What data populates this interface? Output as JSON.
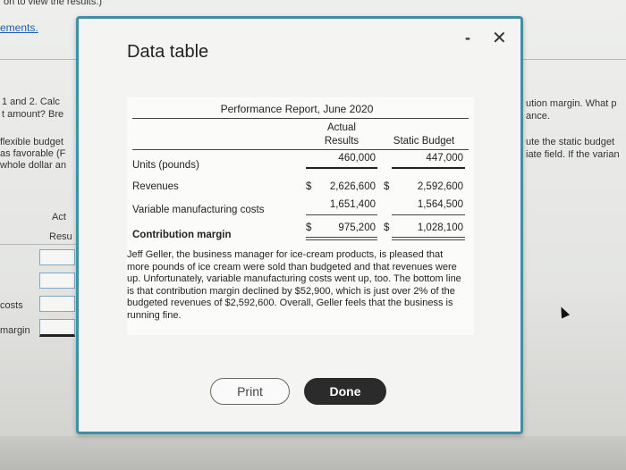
{
  "background": {
    "top_text": "on to view the results.)",
    "link_text": "ements.",
    "left_q1": "1 and 2. Calc",
    "left_q2": "t amount? Bre",
    "left_p1": "flexible budget",
    "left_p2": "as favorable (F",
    "left_p3": "whole dollar an",
    "col_actual": "Act",
    "col_results": "Resu",
    "row_costs": "costs",
    "row_margin": "margin",
    "right_1": "ution margin. What p",
    "right_2": "ance.",
    "right_3": "ute the static budget",
    "right_4": "iate field. If the varian"
  },
  "modal": {
    "title": "Data table",
    "minimize_symbol": "-",
    "close_symbol": "✕",
    "report": {
      "title": "Performance Report, June 2020",
      "col_actual_1": "Actual",
      "col_actual_2": "Results",
      "col_static": "Static Budget",
      "rows": {
        "units": {
          "label": "Units (pounds)",
          "actual": "460,000",
          "static": "447,000"
        },
        "revenues": {
          "label": "Revenues",
          "actual_sym": "$",
          "actual": "2,626,600",
          "static_sym": "$",
          "static": "2,592,600"
        },
        "variable": {
          "label": "Variable manufacturing costs",
          "actual": "1,651,400",
          "static": "1,564,500"
        },
        "margin": {
          "label": "Contribution margin",
          "actual_sym": "$",
          "actual": "975,200",
          "static_sym": "$",
          "static": "1,028,100"
        }
      },
      "narrative": "Jeff Geller, the business manager for ice-cream products, is pleased that more pounds of ice cream were sold than budgeted and that revenues were up. Unfortunately, variable manufacturing costs went up, too. The bottom line is that contribution margin declined by $52,900, which is just over 2% of the budgeted revenues of $2,592,600. Overall, Geller feels that the business is running fine."
    },
    "print_label": "Print",
    "done_label": "Done"
  }
}
